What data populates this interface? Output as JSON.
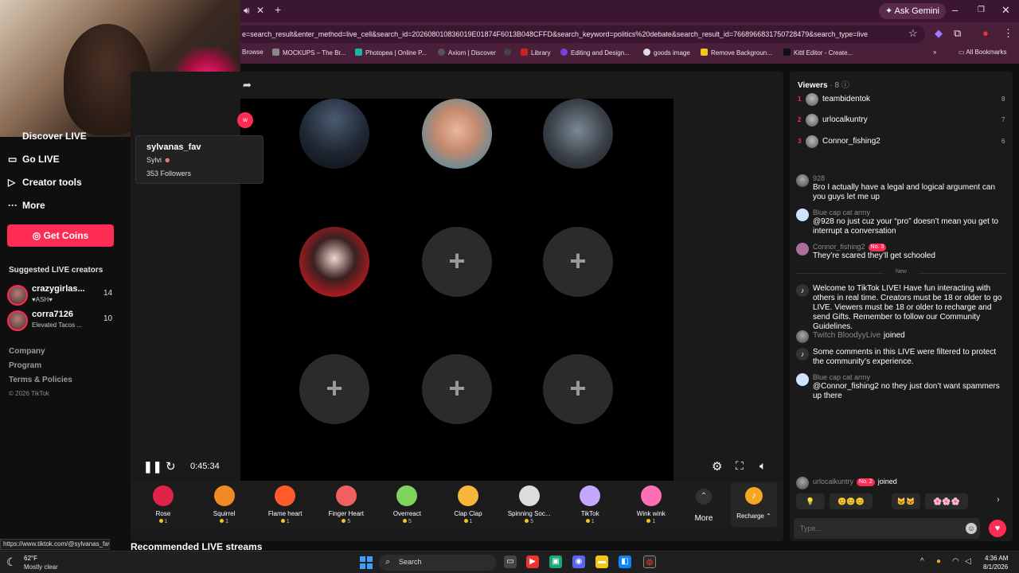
{
  "browser": {
    "tab_close": "✕",
    "new_tab": "+",
    "gemini_label": "Ask Gemini",
    "url": "e=search_result&enter_method=live_cell&search_id=202608010836019E01874F6013B048CFFD&search_keyword=politics%20debate&search_result_id=7668966831750728479&search_type=live",
    "bookmarks": [
      "Browse",
      "MOCKUPS – The Br...",
      "Photopea | Online P...",
      "Axiom | Discover",
      "Library",
      "Editing and Design...",
      "goods image",
      "Remove Backgroun...",
      "Kittl Editor - Create..."
    ],
    "all_bookmarks": "All Bookmarks"
  },
  "sidebar": {
    "items": [
      {
        "label": "Discover LIVE"
      },
      {
        "label": "Go LIVE"
      },
      {
        "label": "Creator tools"
      },
      {
        "label": "More"
      }
    ],
    "coins_label": "Get Coins",
    "suggested_title": "Suggested LIVE creators",
    "creators": [
      {
        "name": "crazygirlas...",
        "sub": "♥ASH♥",
        "count": "14"
      },
      {
        "name": "corra7126",
        "sub": "Elevated Tacos ...",
        "count": "10"
      }
    ],
    "footer": [
      "Company",
      "Program",
      "Terms & Policies"
    ],
    "copyright": "© 2026 TikTok"
  },
  "profile_card": {
    "name": "sylvanas_fav",
    "nickname": "Sylvi",
    "followers": "353 Followers",
    "follow_btn": "w"
  },
  "player": {
    "time": "0:45:34",
    "plus": "+"
  },
  "gifts": [
    {
      "name": "Rose",
      "price": "1",
      "color": "#e0234b"
    },
    {
      "name": "Squirrel",
      "price": "1",
      "color": "#f08a24"
    },
    {
      "name": "Flame heart",
      "price": "1",
      "color": "#ff5a2a"
    },
    {
      "name": "Finger Heart",
      "price": "5",
      "color": "#f06060"
    },
    {
      "name": "Overreact",
      "price": "5",
      "color": "#7fd35a"
    },
    {
      "name": "Clap Clap",
      "price": "1",
      "color": "#f5b83a"
    },
    {
      "name": "Spinning Soc...",
      "price": "5",
      "color": "#dcdcdc"
    },
    {
      "name": "TikTok",
      "price": "1",
      "color": "#c4a8ff"
    },
    {
      "name": "Wink wink",
      "price": "1",
      "color": "#ff6fb5"
    }
  ],
  "more_label": "More",
  "recharge_label": "Recharge ⌃",
  "recommended_title": "Recommended LIVE streams",
  "status_url": "https://www.tiktok.com/@sylvanas_fav",
  "viewers": {
    "title": "Viewers",
    "count": "· 8",
    "list": [
      {
        "rank": "1",
        "name": "teambidentok",
        "count": "8"
      },
      {
        "rank": "2",
        "name": "urlocalkuntry",
        "count": "7"
      },
      {
        "rank": "3",
        "name": "Connor_fishing2",
        "count": "6"
      }
    ]
  },
  "chat": {
    "comments": [
      {
        "user": "928",
        "text": "Bro I actually have a legal and logical argument can you guys let me up"
      },
      {
        "user": "Blue cap cat army",
        "text": "@928 no just cuz your “pro” doesn’t mean you get to interrupt a conversation"
      },
      {
        "user": "Connor_fishing2",
        "badge": "No. 3",
        "text": "They’re scared they’ll get schooled"
      }
    ],
    "new_divider": "New",
    "welcome": "Welcome to TikTok LIVE! Have fun interacting with others in real time. Creators must be 18 or older to go LIVE. Viewers must be 18 or older to recharge and send Gifts. Remember to follow our Community Guidelines.",
    "join1_user": "Twitch BloodyyLive",
    "joined_word": "joined",
    "filter_notice": "Some comments in this LIVE were filtered to protect the community’s experience.",
    "reply_user": "Blue cap cat army",
    "reply_text": "@Connor_fishing2 no they just don’t want spammers up there",
    "join2_user": "urlocalkuntry",
    "join2_badge": "No. 2",
    "quick_emojis": [
      "💡",
      "😊😊😊",
      "🐱🐱",
      "🌸🌸🌸"
    ],
    "input_placeholder": "Type..."
  },
  "taskbar": {
    "temp": "62°F",
    "weather": "Mostly clear",
    "search_label": "Search",
    "time": "4:36 AM",
    "date": "8/1/2026"
  },
  "colors": {
    "accent": "#fe2c55",
    "chrome": "#4a1f3a"
  }
}
